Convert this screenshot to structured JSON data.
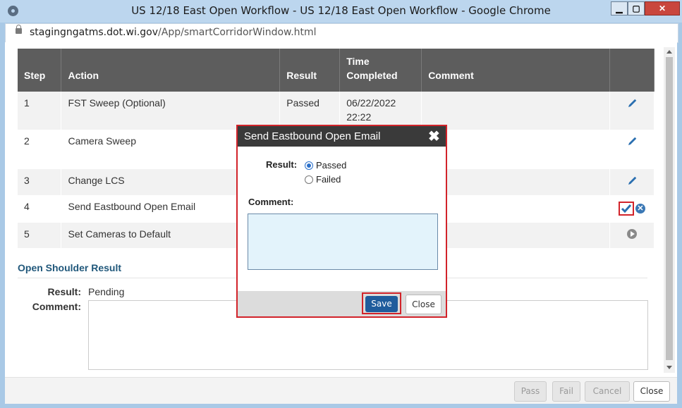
{
  "window": {
    "title": "US 12/18 East Open Workflow - US 12/18 East Open Workflow - Google Chrome",
    "min_glyph": "▁",
    "max_glyph": "▢",
    "close_glyph": "✕"
  },
  "address": {
    "host": "stagingngatms.dot.wi.gov",
    "path": "/App/smartCorridorWindow.html"
  },
  "table": {
    "headers": [
      "Step",
      "Action",
      "Result",
      "Time Completed",
      "Comment",
      ""
    ],
    "rows": [
      {
        "step": "1",
        "action": "FST Sweep (Optional)",
        "result": "Passed",
        "time": "06/22/2022 22:22",
        "comment": "",
        "icon": "pencil-icon"
      },
      {
        "step": "2",
        "action": "Camera Sweep",
        "result": "",
        "time": "",
        "comment": "",
        "icon": "pencil-icon"
      },
      {
        "step": "3",
        "action": "Change LCS",
        "result": "",
        "time": "",
        "comment": "",
        "icon": "pencil-icon"
      },
      {
        "step": "4",
        "action": "Send Eastbound Open Email",
        "result": "",
        "time": "",
        "comment": "",
        "icon": "check-icon"
      },
      {
        "step": "5",
        "action": "Set Cameras to Default",
        "result": "",
        "time": "",
        "comment": "",
        "icon": "play-icon"
      }
    ]
  },
  "shoulder": {
    "title": "Open Shoulder Result",
    "result_label": "Result:",
    "result_value": "Pending",
    "comment_label": "Comment:"
  },
  "footer": {
    "pass": "Pass",
    "fail": "Fail",
    "cancel": "Cancel",
    "close": "Close"
  },
  "modal": {
    "title": "Send Eastbound Open Email",
    "close_glyph": "✖",
    "result_label": "Result:",
    "options": [
      "Passed",
      "Failed"
    ],
    "selected": "Passed",
    "comment_label": "Comment:",
    "comment_value": "",
    "save": "Save",
    "close": "Close"
  },
  "colors": {
    "header_bg": "#5d5d5d",
    "highlight": "#d2232a",
    "primary": "#1f5c9c",
    "section_title": "#21587b"
  }
}
